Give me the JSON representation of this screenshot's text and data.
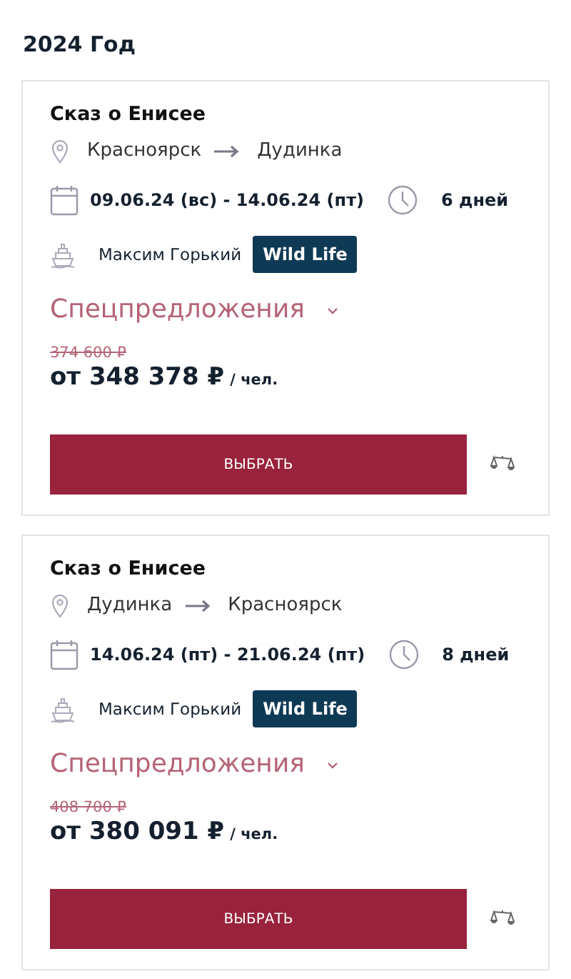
{
  "heading": "2024 Год",
  "cruises": [
    {
      "title": "Сказ о Енисее",
      "from": "Красноярск",
      "to": "Дудинка",
      "dates": "09.06.24 (вс) - 14.06.24 (пт)",
      "duration": "6 дней",
      "ship": "Максим Горький",
      "tag": "Wild Life",
      "offers": "Спецпредложения",
      "old_price": "374 600 ₽",
      "price": "от 348 378 ₽",
      "unit": "/ чел.",
      "button": "ВЫБРАТЬ"
    },
    {
      "title": "Сказ о Енисее",
      "from": "Дудинка",
      "to": "Красноярск",
      "dates": "14.06.24 (пт) - 21.06.24 (пт)",
      "duration": "8 дней",
      "ship": "Максим Горький",
      "tag": "Wild Life",
      "offers": "Спецпредложения",
      "old_price": "408 700 ₽",
      "price": "от 380 091 ₽",
      "unit": "/ чел.",
      "button": "ВЫБРАТЬ"
    }
  ]
}
